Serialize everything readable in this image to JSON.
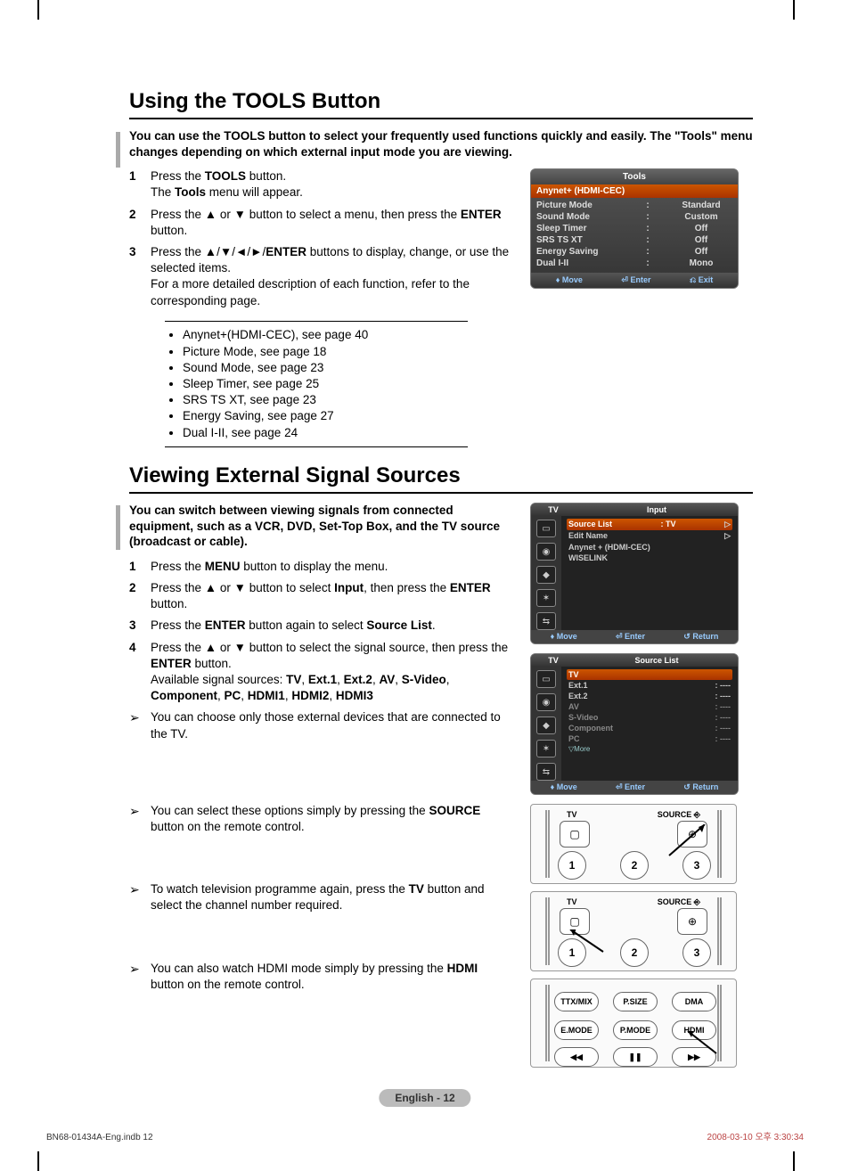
{
  "section1": {
    "title": "Using the TOOLS Button",
    "intro": "You can use the TOOLS button to select your frequently used functions quickly and easily. The \"Tools\" menu changes depending on which external input mode you are viewing.",
    "steps": [
      {
        "n": "1",
        "body_pre": "Press the ",
        "b1": "TOOLS",
        "body_mid": " button.\nThe ",
        "b2": "Tools",
        "body_post": " menu will appear."
      },
      {
        "n": "2",
        "body_pre": "Press the ▲ or ▼ button to select a menu, then press the ",
        "b1": "ENTER",
        "body_post": " button."
      },
      {
        "n": "3",
        "body_pre": "Press the ▲/▼/◄/►/",
        "b1": "ENTER",
        "body_mid": " buttons to display, change, or use the selected items.\nFor a more detailed description of each function, refer to the corresponding page."
      }
    ],
    "bullets": [
      "Anynet+(HDMI-CEC), see page 40",
      "Picture Mode, see page 18",
      "Sound Mode, see page 23",
      "Sleep Timer, see page 25",
      "SRS TS XT, see page 23",
      "Energy Saving, see page 27",
      "Dual I-II, see page 24"
    ],
    "osd": {
      "title": "Tools",
      "highlight": "Anynet+ (HDMI-CEC)",
      "rows": [
        {
          "label": "Picture Mode",
          "value": "Standard"
        },
        {
          "label": "Sound Mode",
          "value": "Custom"
        },
        {
          "label": "Sleep Timer",
          "value": "Off"
        },
        {
          "label": "SRS TS XT",
          "value": "Off"
        },
        {
          "label": "Energy Saving",
          "value": "Off"
        },
        {
          "label": "Dual I-II",
          "value": "Mono"
        }
      ],
      "foot_move": "Move",
      "foot_enter": "Enter",
      "foot_exit": "Exit"
    }
  },
  "section2": {
    "title": "Viewing External Signal Sources",
    "intro": "You can switch between viewing signals from connected equipment, such as a VCR, DVD, Set-Top Box, and the TV source (broadcast or cable).",
    "steps": [
      {
        "n": "1",
        "pre": "Press the ",
        "b1": "MENU",
        "post": " button to display the menu."
      },
      {
        "n": "2",
        "pre": "Press the ▲ or ▼ button to select ",
        "b1": "Input",
        "mid": ", then press the ",
        "b2": "ENTER",
        "post": " button."
      },
      {
        "n": "3",
        "pre": "Press the ",
        "b1": "ENTER",
        "mid": " button again to select ",
        "b2": "Source List",
        "post": "."
      },
      {
        "n": "4",
        "pre": "Press the ▲ or ▼ button to select the signal source, then press the ",
        "b1": "ENTER",
        "post": " button."
      }
    ],
    "avail_pre": "Available signal sources: ",
    "avail_list": "TV, Ext.1, Ext.2, AV, S-Video, Component, PC, HDMI1, HDMI2, HDMI3",
    "note1": "You can choose only those external devices that are connected to the TV.",
    "note2_pre": "You can select these options simply by pressing the ",
    "note2_b": "SOURCE",
    "note2_post": " button on the remote control.",
    "note3_pre": "To watch television programme again, press the ",
    "note3_b": "TV",
    "note3_post": " button and select the channel number required.",
    "note4_pre": "You can also watch HDMI mode simply by pressing the ",
    "note4_b": "HDMI",
    "note4_post": " button on the remote control.",
    "menu1": {
      "tab_left": "TV",
      "tab_right": "Input",
      "hl_label": "Source List",
      "hl_value": ": TV",
      "items": [
        "Edit Name",
        "Anynet + (HDMI-CEC)",
        "WISELINK"
      ],
      "foot_move": "Move",
      "foot_enter": "Enter",
      "foot_return": "Return"
    },
    "menu2": {
      "tab_left": "TV",
      "tab_right": "Source List",
      "hl": "TV",
      "items": [
        {
          "l": "Ext.1",
          "v": ": ----"
        },
        {
          "l": "Ext.2",
          "v": ": ----"
        },
        {
          "l": "AV",
          "v": ": ----"
        },
        {
          "l": "S-Video",
          "v": ": ----"
        },
        {
          "l": "Component",
          "v": ": ----"
        },
        {
          "l": "PC",
          "v": ": ----"
        }
      ],
      "more": "▽More",
      "foot_move": "Move",
      "foot_enter": "Enter",
      "foot_return": "Return"
    },
    "remote": {
      "tv": "TV",
      "source": "SOURCE",
      "b1": "1",
      "b2": "2",
      "b3": "3",
      "ttx": "TTX/MIX",
      "psize": "P.SIZE",
      "dma": "DMA",
      "emode": "E.MODE",
      "pmode": "P.MODE",
      "hdmi": "HDMI"
    }
  },
  "footer": {
    "page": "English - 12",
    "indb": "BN68-01434A-Eng.indb   12",
    "date": "2008-03-10   오후 3:30:34"
  }
}
